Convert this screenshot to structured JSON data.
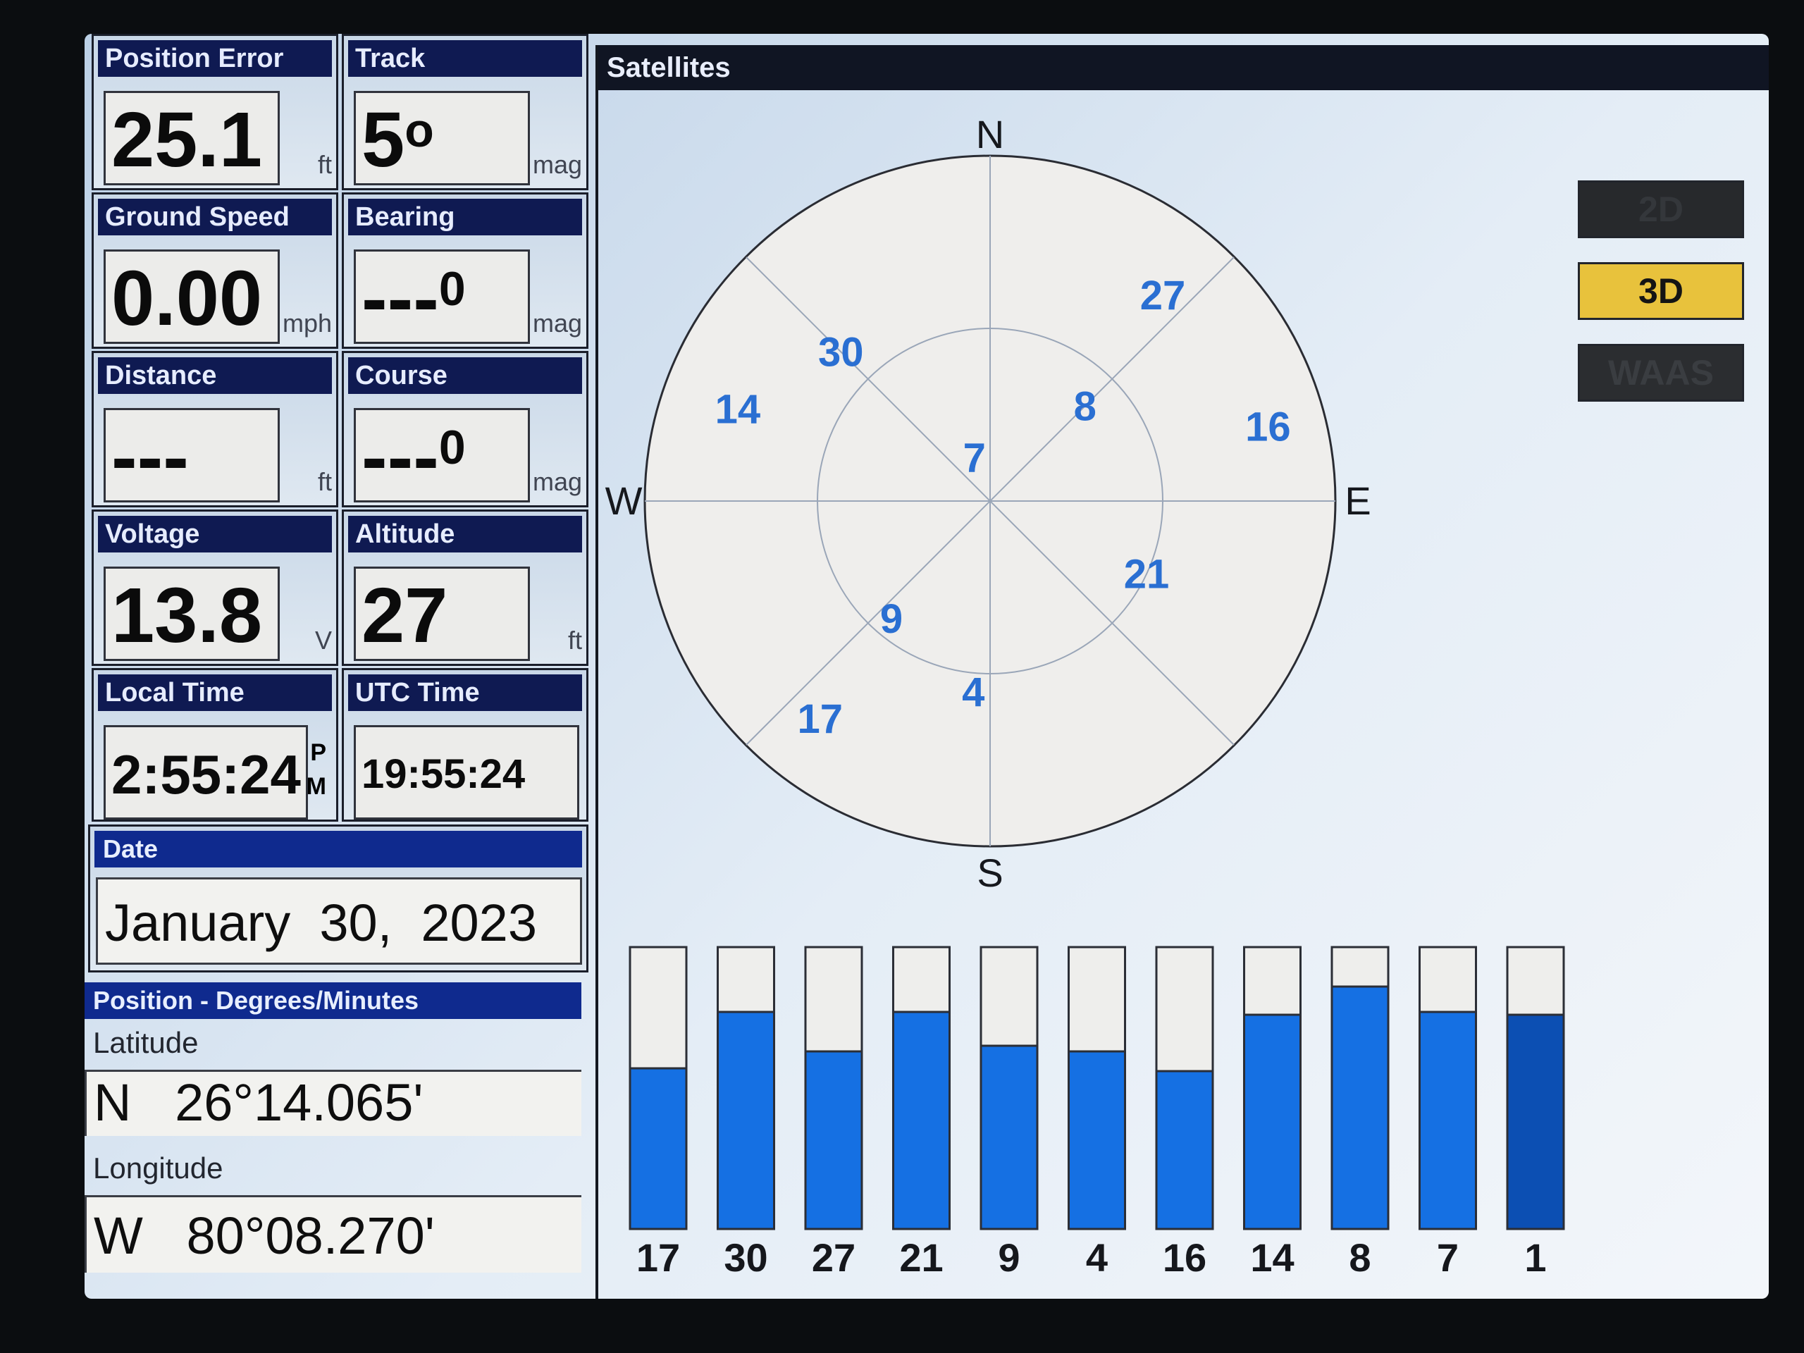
{
  "tiles": {
    "position_error": {
      "title": "Position Error",
      "value": "25.1",
      "unit": "ft"
    },
    "track": {
      "title": "Track",
      "value": "5",
      "degree": "o",
      "unit": "mag"
    },
    "ground_speed": {
      "title": "Ground Speed",
      "value": "0.00",
      "unit": "mph"
    },
    "bearing": {
      "title": "Bearing",
      "value": "---",
      "degree": "0",
      "unit": "mag"
    },
    "distance": {
      "title": "Distance",
      "value": "---",
      "unit": "ft"
    },
    "course": {
      "title": "Course",
      "value": "---",
      "degree": "0",
      "unit": "mag"
    },
    "voltage": {
      "title": "Voltage",
      "value": "13.8",
      "unit": "V"
    },
    "altitude": {
      "title": "Altitude",
      "value": "27",
      "unit": "ft"
    },
    "local_time": {
      "title": "Local Time",
      "value": "2:55:24",
      "ampm_top": "P",
      "ampm_bottom": "M"
    },
    "utc_time": {
      "title": "UTC Time",
      "value": "19:55:24"
    }
  },
  "date": {
    "title": "Date",
    "value": "January  30,  2023"
  },
  "position": {
    "title": "Position - Degrees/Minutes",
    "latitude_label": "Latitude",
    "latitude_value": "N   26°14.065'",
    "longitude_label": "Longitude",
    "longitude_value": "W   80°08.270'"
  },
  "satellites": {
    "title": "Satellites",
    "compass": {
      "n": "N",
      "s": "S",
      "e": "E",
      "w": "W"
    },
    "modes": [
      {
        "label": "2D",
        "state": "inactive"
      },
      {
        "label": "3D",
        "state": "active"
      },
      {
        "label": "WAAS",
        "state": "inactive"
      }
    ],
    "sky_labels": [
      {
        "id": "30",
        "az": 315,
        "el": 35
      },
      {
        "id": "27",
        "az": 40,
        "el": 20
      },
      {
        "id": "8",
        "az": 45,
        "el": 55
      },
      {
        "id": "14",
        "az": 290,
        "el": 20
      },
      {
        "id": "7",
        "az": 340,
        "el": 78
      },
      {
        "id": "16",
        "az": 75,
        "el": 15
      },
      {
        "id": "21",
        "az": 115,
        "el": 45
      },
      {
        "id": "9",
        "az": 220,
        "el": 50
      },
      {
        "id": "17",
        "az": 218,
        "el": 18
      },
      {
        "id": "4",
        "az": 185,
        "el": 40
      }
    ],
    "colors": {
      "label": "#2a6fd2",
      "bar": "#1570e3",
      "bar_dark": "#0c4fb3",
      "bar_empty": "#eeeeec"
    }
  },
  "chart_data": {
    "type": "bar",
    "categories": [
      "17",
      "30",
      "27",
      "21",
      "9",
      "4",
      "16",
      "14",
      "8",
      "7",
      "1"
    ],
    "values": [
      57,
      77,
      63,
      77,
      65,
      63,
      56,
      76,
      86,
      77,
      76
    ],
    "ylim": [
      0,
      100
    ],
    "title": "",
    "xlabel": "",
    "ylabel": ""
  }
}
